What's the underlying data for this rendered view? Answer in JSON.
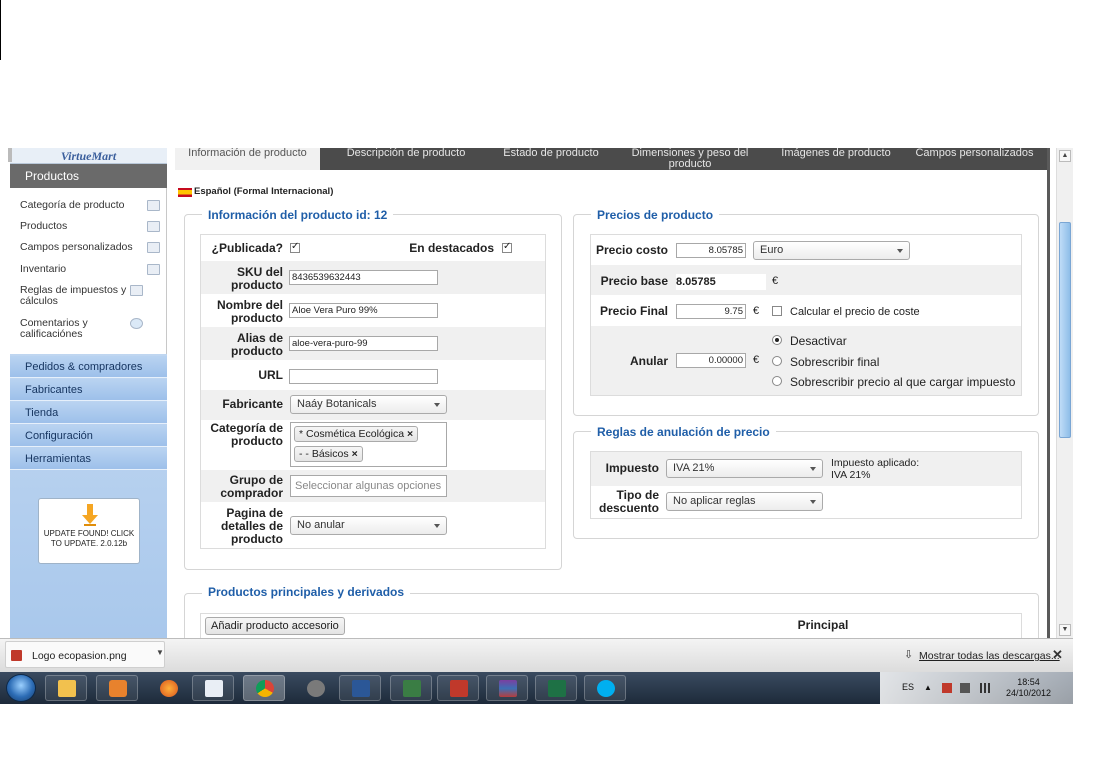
{
  "sidebar": {
    "logo": "VirtueMart",
    "header": "Productos",
    "sub_items": [
      {
        "label": "Categoría de producto",
        "icon": "folder-icon"
      },
      {
        "label": "Productos",
        "icon": "box-icon"
      },
      {
        "label": "Campos personalizados",
        "icon": "fields-icon"
      },
      {
        "label": "Inventario",
        "icon": "chart-icon"
      },
      {
        "label": "Reglas de impuestos y cálculos",
        "icon": "calculator-icon"
      },
      {
        "label": "Comentarios y calificaciónes",
        "icon": "comment-icon"
      }
    ],
    "nav": [
      "Pedidos & compradores",
      "Fabricantes",
      "Tienda",
      "Configuración",
      "Herramientas"
    ],
    "update": "UPDATE FOUND! CLICK TO UPDATE. 2.0.12b"
  },
  "tabs": [
    "Información de producto",
    "Descripción de producto",
    "Estado de producto",
    "Dimensiones y peso del producto",
    "Imágenes de producto",
    "Campos personalizados"
  ],
  "language": "Español (Formal Internacional)",
  "info": {
    "legend": "Información del producto id: 12",
    "published_label": "¿Publicada?",
    "featured_label": "En destacados",
    "sku_label": "SKU del producto",
    "sku_value": "8436539632443",
    "name_label": "Nombre del producto",
    "name_value": "Aloe Vera Puro 99%",
    "alias_label": "Alias de producto",
    "alias_value": "aloe-vera-puro-99",
    "url_label": "URL",
    "url_value": "",
    "manufacturer_label": "Fabricante",
    "manufacturer_value": "Naáy Botanicals",
    "category_label": "Categoría de producto",
    "categories": [
      "* Cosmética Ecológica",
      "- - Básicos"
    ],
    "group_label": "Grupo de comprador",
    "group_placeholder": "Seleccionar algunas opciones",
    "details_label": "Pagina de detalles de producto",
    "details_value": "No anular"
  },
  "prices": {
    "legend": "Precios de producto",
    "cost_label": "Precio costo",
    "cost_value": "8.05785",
    "currency": "Euro",
    "base_label": "Precio base",
    "base_value": "8.05785",
    "euro": "€",
    "final_label": "Precio Final",
    "final_value": "9.75",
    "calc_label": "Calcular el precio de coste",
    "override_label": "Anular",
    "override_value": "0.00000",
    "radio_off": "Desactivar",
    "radio_final": "Sobrescribir final",
    "radio_tax": "Sobrescribir precio al que cargar impuesto"
  },
  "rules": {
    "legend": "Reglas de anulación de precio",
    "tax_label": "Impuesto",
    "tax_value": "IVA 21%",
    "applied_label": "Impuesto aplicado:",
    "applied_value": "IVA 21%",
    "discount_label": "Tipo de descuento",
    "discount_value": "No aplicar reglas"
  },
  "related": {
    "legend": "Productos principales y derivados",
    "add_button": "Añadir producto accesorio",
    "principal_header": "Principal"
  },
  "downloads": {
    "file": "Logo ecopasion.png",
    "show_all": "Mostrar todas las descargas..."
  },
  "taskbar": {
    "lang": "ES",
    "time": "18:54",
    "date": "24/10/2012"
  }
}
